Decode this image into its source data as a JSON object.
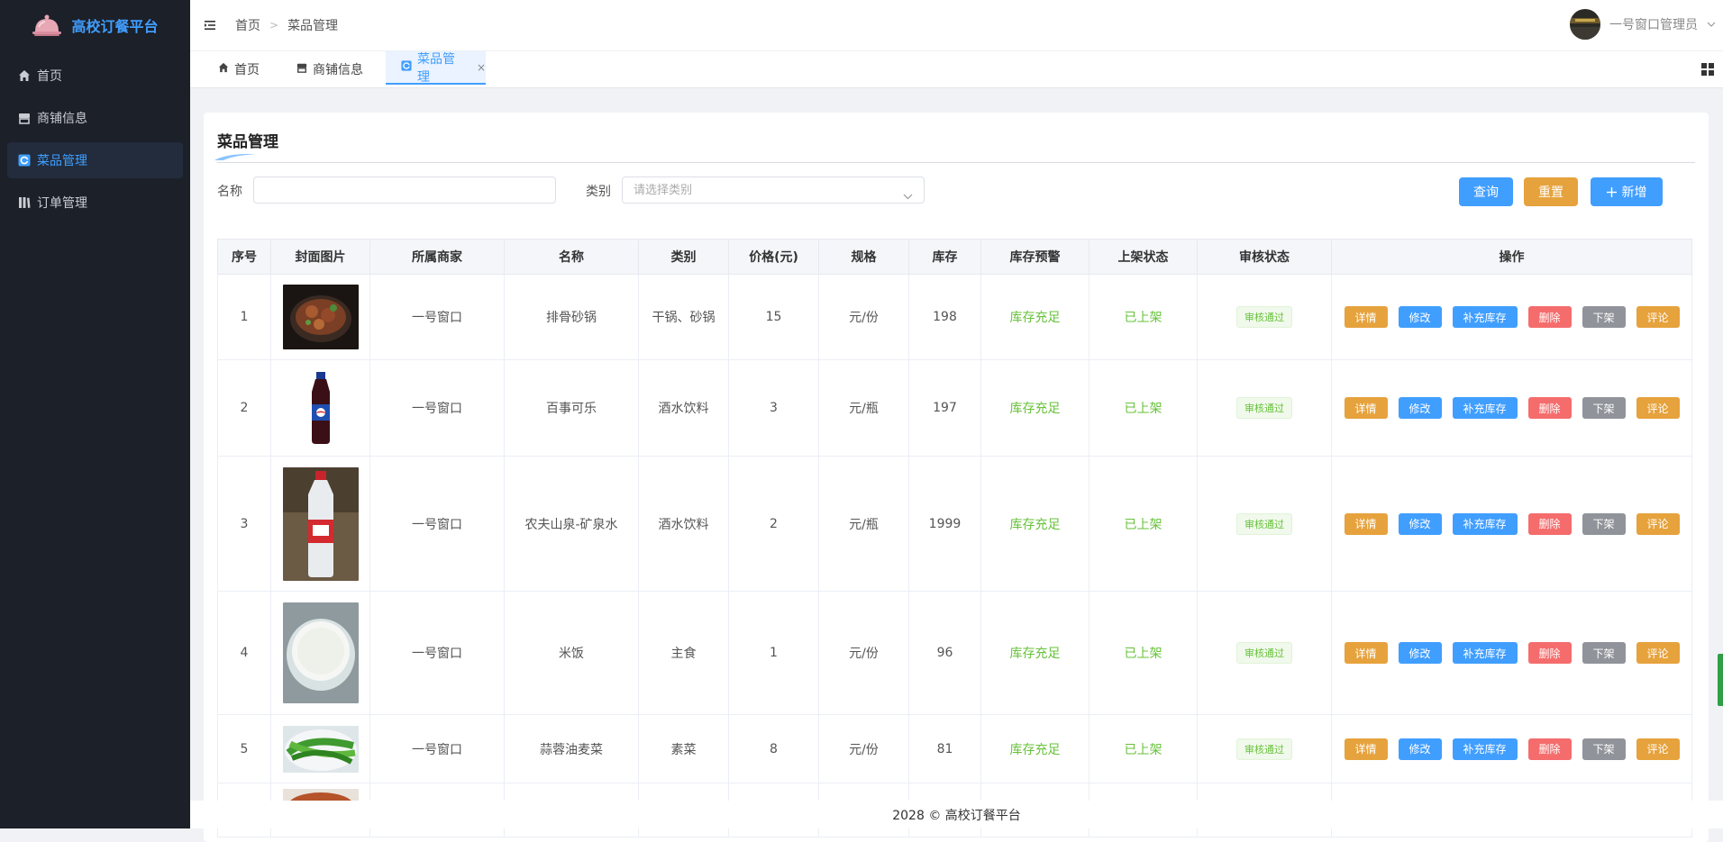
{
  "brand": {
    "title": "高校订餐平台"
  },
  "sidebar": {
    "items": [
      {
        "label": "首页",
        "icon": "home-icon",
        "active": false
      },
      {
        "label": "商铺信息",
        "icon": "shop-icon",
        "active": false
      },
      {
        "label": "菜品管理",
        "icon": "dish-icon",
        "active": true
      },
      {
        "label": "订单管理",
        "icon": "order-icon",
        "active": false
      }
    ]
  },
  "header": {
    "breadcrumb": [
      "首页",
      "菜品管理"
    ],
    "user": "一号窗口管理员"
  },
  "tabs": [
    {
      "label": "首页",
      "icon": "home-icon"
    },
    {
      "label": "商铺信息",
      "icon": "shop-icon"
    },
    {
      "label": "菜品管理",
      "icon": "dish-icon",
      "active": true,
      "close": "×"
    }
  ],
  "page": {
    "title": "菜品管理",
    "search": {
      "name_label": "名称",
      "name_value": "",
      "category_label": "类别",
      "category_placeholder": "请选择类别",
      "query_button": "查询",
      "reset_button": "重置",
      "add_button": "新增"
    }
  },
  "colors": {
    "primary": "#409eff",
    "warning": "#e6a23c",
    "danger": "#f56c6c",
    "info": "#909399",
    "success": "#67c23a",
    "sidebar": "#1c2029"
  },
  "table": {
    "headers": [
      "序号",
      "封面图片",
      "所属商家",
      "名称",
      "类别",
      "价格(元)",
      "规格",
      "库存",
      "库存预警",
      "上架状态",
      "审核状态",
      "操作"
    ],
    "actions": [
      "详情",
      "修改",
      "补充库存",
      "删除",
      "下架",
      "评论"
    ],
    "rows": [
      {
        "no": "1",
        "image": "claypot-ribs-photo",
        "merchant": "一号窗口",
        "name": "排骨砂锅",
        "category": "干锅、砂锅",
        "price": "15",
        "spec": "元/份",
        "stock": "198",
        "warning": "库存充足",
        "shelf": "已上架",
        "audit": "审核通过"
      },
      {
        "no": "2",
        "image": "pepsi-bottle-photo",
        "merchant": "一号窗口",
        "name": "百事可乐",
        "category": "酒水饮料",
        "price": "3",
        "spec": "元/瓶",
        "stock": "197",
        "warning": "库存充足",
        "shelf": "已上架",
        "audit": "审核通过"
      },
      {
        "no": "3",
        "image": "water-bottle-photo",
        "merchant": "一号窗口",
        "name": "农夫山泉-矿泉水",
        "category": "酒水饮料",
        "price": "2",
        "spec": "元/瓶",
        "stock": "1999",
        "warning": "库存充足",
        "shelf": "已上架",
        "audit": "审核通过"
      },
      {
        "no": "4",
        "image": "rice-bowl-photo",
        "merchant": "一号窗口",
        "name": "米饭",
        "category": "主食",
        "price": "1",
        "spec": "元/份",
        "stock": "96",
        "warning": "库存充足",
        "shelf": "已上架",
        "audit": "审核通过"
      },
      {
        "no": "5",
        "image": "garlic-greens-photo",
        "merchant": "一号窗口",
        "name": "蒜蓉油麦菜",
        "category": "素菜",
        "price": "8",
        "spec": "元/份",
        "stock": "81",
        "warning": "库存充足",
        "shelf": "已上架",
        "audit": "审核通过"
      }
    ]
  },
  "footer": {
    "text": "2028 © 高校订餐平台"
  }
}
